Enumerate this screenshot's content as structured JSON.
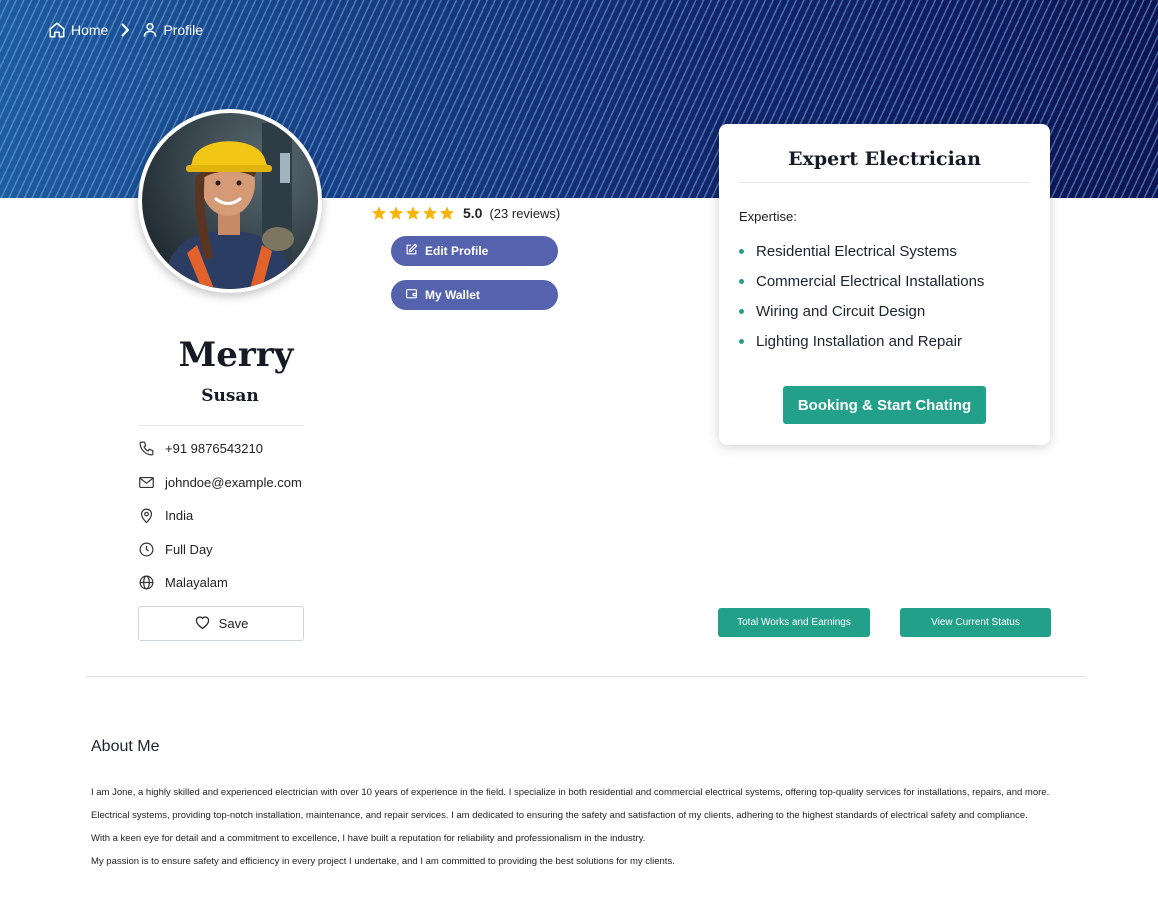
{
  "breadcrumb": {
    "home": "Home",
    "profile": "Profile"
  },
  "rating": {
    "score": "5.0",
    "reviews": "(23 reviews)",
    "stars": 5
  },
  "actions": {
    "edit_profile": "Edit Profile",
    "wallet": "My Wallet"
  },
  "profile": {
    "first_name": "Merry",
    "last_name": "Susan"
  },
  "contacts": {
    "phone": "+91 9876543210",
    "email": "johndoe@example.com",
    "location": "India",
    "availability": "Full Day",
    "language": "Malayalam"
  },
  "save_label": "Save",
  "expert_card": {
    "title": "Expert Electrician",
    "expertise_label": "Expertise:",
    "items": [
      "Residential Electrical Systems",
      "Commercial Electrical Installations",
      "Wiring and Circuit Design",
      "Lighting Installation and Repair"
    ],
    "booking_label": "Booking & Start Chating"
  },
  "buttons": {
    "works": "Total Works and Earnings",
    "status": "View Current Status"
  },
  "about": {
    "title": "About Me",
    "paragraphs": [
      "I am Jone, a highly skilled and experienced electrician with over 10 years of experience in the field. I specialize in both residential and commercial electrical systems, offering top-quality services for installations, repairs, and more.",
      "Electrical systems, providing top-notch installation, maintenance, and repair services. I am dedicated to ensuring the safety and satisfaction of my clients, adhering to the highest standards of electrical safety and compliance.",
      "With a keen eye for detail and a commitment to excellence, I have built a reputation for reliability and professionalism in the industry.",
      "My passion is to ensure safety and efficiency in every project I undertake, and I am committed to providing the best solutions for my clients."
    ]
  },
  "colors": {
    "accent_teal": "#22a08a",
    "accent_indigo": "#5562ad",
    "banner_navy": "#101a5a",
    "star": "#f5b50a"
  }
}
